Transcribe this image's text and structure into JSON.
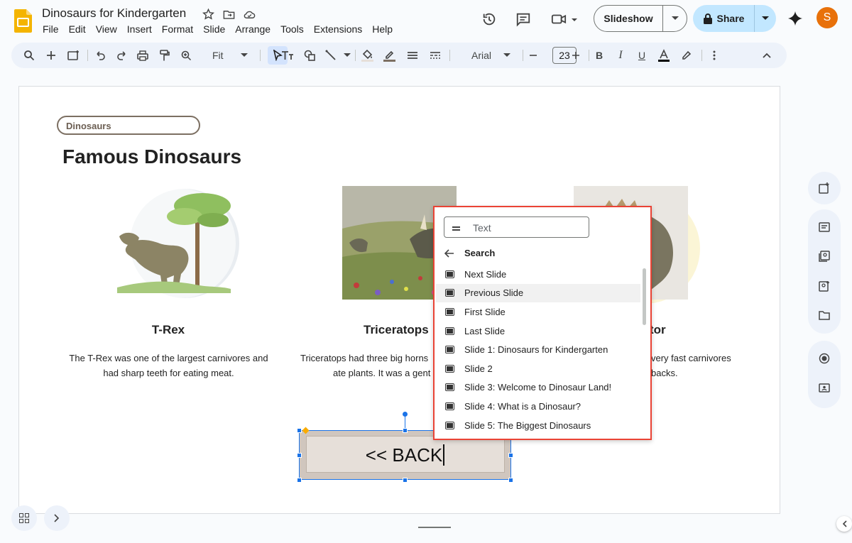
{
  "doc": {
    "title": "Dinosaurs for Kindergarten",
    "menus": [
      "File",
      "Edit",
      "View",
      "Insert",
      "Format",
      "Slide",
      "Arrange",
      "Tools",
      "Extensions",
      "Help"
    ]
  },
  "header": {
    "slideshow_label": "Slideshow",
    "share_label": "Share",
    "avatar_letter": "S"
  },
  "toolbar": {
    "zoom": "Fit",
    "font": "Arial",
    "font_size": "23"
  },
  "slide": {
    "tag": "Dinosaurs",
    "heading": "Famous Dinosaurs",
    "cards": [
      {
        "name": "T-Rex",
        "desc_line1": "The T-Rex was one of the largest carnivores and",
        "desc_line2": "had sharp teeth for eating meat."
      },
      {
        "name": "Triceratops",
        "desc_line1": "Triceratops had three big horns",
        "desc_line2": "ate plants. It was a gent"
      },
      {
        "name": "tor",
        "desc_line1": "very fast carnivores",
        "desc_line2": "backs."
      }
    ],
    "button_text": "<< BACK"
  },
  "link_popup": {
    "placeholder": "Text",
    "search_label": "Search",
    "items": [
      "Next Slide",
      "Previous Slide",
      "First Slide",
      "Last Slide",
      "Slide 1: Dinosaurs for Kindergarten",
      "Slide 2",
      "Slide 3: Welcome to Dinosaur Land!",
      "Slide 4: What is a Dinosaur?",
      "Slide 5: The Biggest Dinosaurs"
    ],
    "highlighted_index": 1
  },
  "colors": {
    "accent": "#1a73e8",
    "share_bg": "#c2e7ff",
    "popup_border": "#ea4335",
    "avatar": "#e8710a"
  }
}
